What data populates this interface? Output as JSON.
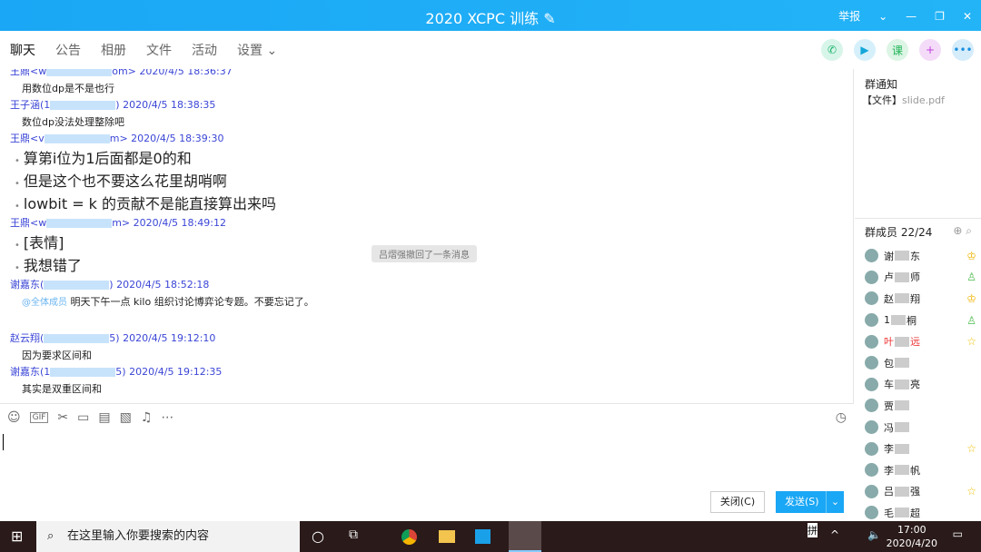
{
  "window": {
    "title": "2020 XCPC 训练",
    "report": "举报"
  },
  "tabs": [
    "聊天",
    "公告",
    "相册",
    "文件",
    "活动",
    "设置"
  ],
  "messages": [
    {
      "sender": "王鼎<w",
      "sender_end": "om>",
      "time": "2020/4/5 18:36:37",
      "lines": [
        "用数位dp是不是也行"
      ],
      "style": "small"
    },
    {
      "sender": "王子涵(1",
      "sender_end": ")",
      "time": "2020/4/5 18:38:35",
      "lines": [
        "数位dp没法处理整除吧"
      ],
      "style": "small"
    },
    {
      "sender": "王鼎<v",
      "sender_end": "m>",
      "time": "2020/4/5 18:39:30",
      "lines": [
        "算第i位为1后面都是0的和",
        "但是这个也不要这么花里胡哨啊",
        "lowbit = k 的贡献不是能直接算出来吗"
      ],
      "style": "big"
    },
    {
      "sender": "王鼎<w",
      "sender_end": "m>",
      "time": "2020/4/5 18:49:12",
      "lines": [
        "[表情]",
        "我想错了"
      ],
      "style": "big"
    },
    {
      "sender": "谢嘉东(",
      "sender_end": ")",
      "time": "2020/4/5 18:52:18",
      "mention": "@全体成员",
      "lines": [
        "明天下午一点 kilo 组织讨论博弈论专题。不要忘记了。"
      ],
      "style": "small"
    },
    {
      "sender": "赵云翔(",
      "sender_end": "5)",
      "time": "2020/4/5 19:12:10",
      "lines": [
        "因为要求区间和"
      ],
      "style": "small"
    },
    {
      "sender": "谢嘉东(1",
      "sender_end": "5)",
      "time": "2020/4/5 19:12:35",
      "lines": [
        "其实是双重区间和"
      ],
      "style": "small"
    }
  ],
  "recall_notice": "吕熠强撤回了一条消息",
  "buttons": {
    "close": "关闭(C)",
    "send": "发送(S)"
  },
  "side": {
    "notice_title": "群通知",
    "notice_file_label": "【文件】",
    "notice_file": "slide.pdf",
    "members_title": "群成员 22/24"
  },
  "members": [
    {
      "a": "谢",
      "b": "东",
      "badge": "owner"
    },
    {
      "a": "卢",
      "b": "师",
      "badge": "admin"
    },
    {
      "a": "赵",
      "b": "翔",
      "badge": "owner"
    },
    {
      "a": "1",
      "b": "桐",
      "badge": "admin"
    },
    {
      "a": "叶",
      "b": "远",
      "badge": "star",
      "red": true
    },
    {
      "a": "包",
      "b": ""
    },
    {
      "a": "车",
      "b": "亮"
    },
    {
      "a": "贾",
      "b": ""
    },
    {
      "a": "冯",
      "b": ""
    },
    {
      "a": "李",
      "b": "",
      "badge": "star"
    },
    {
      "a": "李",
      "b": "帆"
    },
    {
      "a": "吕",
      "b": "强",
      "badge": "star"
    },
    {
      "a": "毛",
      "b": "超"
    }
  ],
  "taskbar": {
    "search": "在这里输入你要搜索的内容",
    "time": "17:00",
    "date": "2020/4/20",
    "ime": "拼"
  }
}
